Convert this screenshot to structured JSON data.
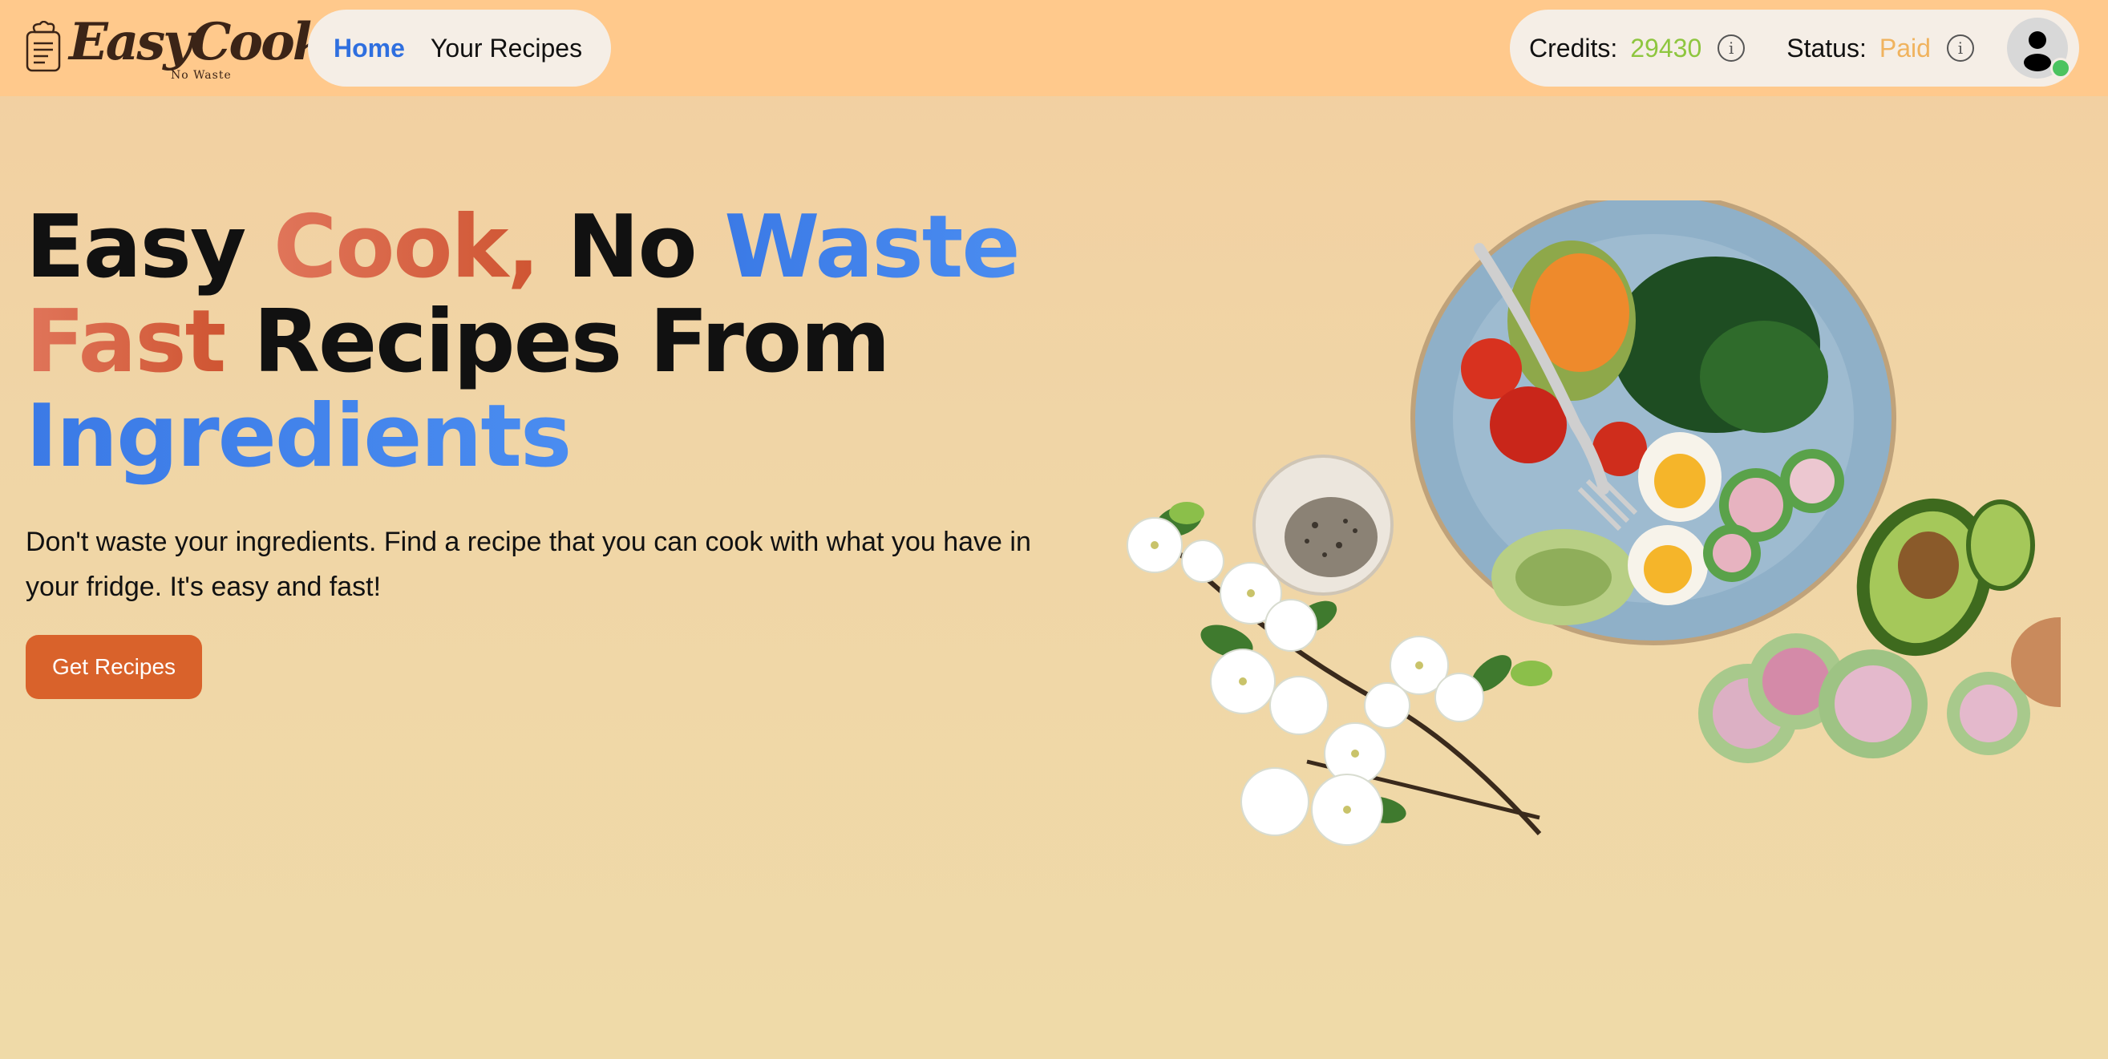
{
  "header": {
    "logo": {
      "name": "EasyCook",
      "tagline": "No Waste"
    },
    "nav": [
      {
        "label": "Home",
        "active": true
      },
      {
        "label": "Your Recipes",
        "active": false
      }
    ],
    "credits": {
      "label": "Credits:",
      "value": "29430",
      "color": "#8ec63f"
    },
    "status": {
      "label": "Status:",
      "value": "Paid",
      "color": "#f0b35e"
    },
    "avatar_online": true
  },
  "hero": {
    "headline": {
      "line1": {
        "w1": "Easy",
        "w2": "Cook,",
        "w3": "No",
        "w4": "Waste"
      },
      "line2": {
        "w1": "Fast",
        "w2": "Recipes From"
      },
      "line3": {
        "w1": "Ingredients"
      }
    },
    "subtitle": "Don't waste your ingredients. Find a recipe that you can cook with what you have in your fridge. It's easy and fast!",
    "cta_label": "Get Recipes"
  },
  "colors": {
    "header_bg": "#ffc98c",
    "accent_orange": "#d9622b",
    "accent_blue": "#3b7ae6",
    "online": "#4cc35f"
  },
  "icons": [
    "chef-notepad-icon",
    "info-icon",
    "user-avatar-icon",
    "online-status-dot"
  ]
}
